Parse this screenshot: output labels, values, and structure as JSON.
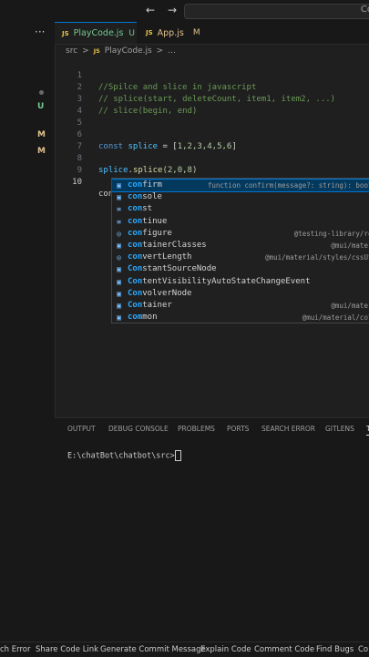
{
  "titlebar": {
    "search_text": "Co"
  },
  "sidebar": {
    "badges": [
      "U",
      "M",
      "M"
    ]
  },
  "tabs": [
    {
      "icon": "JS",
      "label": "PlayCode.js",
      "badge": "U",
      "active": true
    },
    {
      "icon": "JS",
      "label": "App.js",
      "badge": "M",
      "active": false
    }
  ],
  "breadcrumb": {
    "folder": "src",
    "sep": ">",
    "icon": "JS",
    "file": "PlayCode.js",
    "sep2": ">",
    "rest": "..."
  },
  "editor": {
    "line_numbers": [
      "1",
      "2",
      "3",
      "4",
      "5",
      "6",
      "7",
      "8",
      "9",
      "10"
    ],
    "comment1": "//Spilce and slice in javascript",
    "comment2": "// splice(start, deleteCount, item1, item2, ...)",
    "comment3": "// slice(begin, end)",
    "l6_kw": "const",
    "l6_var": "splice",
    "l6_eq": " = [",
    "l6_nums": "1,2,3,4,5,6",
    "l6_end": "]",
    "l8_var": "splice",
    "l8_dot": ".",
    "l8_fn": "splice",
    "l8_args": "(2,0,8)",
    "l10_typed": "con"
  },
  "suggest": {
    "items": [
      {
        "match": "con",
        "rest": "firm",
        "icon": "cube-icon",
        "detail": "function confirm(message?: string): boole"
      },
      {
        "match": "con",
        "rest": "sole",
        "icon": "cube-icon",
        "detail": ""
      },
      {
        "match": "con",
        "rest": "st",
        "icon": "keyword-icon",
        "detail": ""
      },
      {
        "match": "con",
        "rest": "tinue",
        "icon": "keyword-icon",
        "detail": ""
      },
      {
        "match": "con",
        "rest": "figure",
        "icon": "snippet-icon",
        "detail": "@testing-library/rea"
      },
      {
        "match": "con",
        "rest": "tainerClasses",
        "icon": "cube-icon",
        "detail": "@mui/materi"
      },
      {
        "match": "con",
        "rest": "vertLength",
        "icon": "snippet-icon",
        "detail": "@mui/material/styles/cssUti"
      },
      {
        "match": "Con",
        "rest": "stantSourceNode",
        "icon": "cube-icon",
        "detail": ""
      },
      {
        "match": "Con",
        "rest": "tentVisibilityAutoStateChangeEvent",
        "icon": "cube-icon",
        "detail": ""
      },
      {
        "match": "Con",
        "rest": "volverNode",
        "icon": "cube-icon",
        "detail": ""
      },
      {
        "match": "Con",
        "rest": "tainer",
        "icon": "cube-icon",
        "detail": "@mui/materi"
      },
      {
        "match": "com",
        "rest": "mon",
        "icon": "cube-icon",
        "detail": "@mui/material/colo"
      }
    ]
  },
  "panel": {
    "tabs": [
      "OUTPUT",
      "DEBUG CONSOLE",
      "PROBLEMS",
      "PORTS",
      "SEARCH ERROR",
      "GITLENS",
      "T"
    ],
    "terminal_prompt": "E:\\chatBot\\chatbot\\src>"
  },
  "statusbar": {
    "items": [
      "ch Error",
      "Share Code Link",
      "Generate Commit Message",
      "Explain Code",
      "Comment Code",
      "Find Bugs",
      "Co"
    ]
  },
  "colors": {
    "accent": "#0078d4",
    "selection": "#04395e",
    "untracked": "#73c991",
    "modified": "#e2c08d"
  }
}
